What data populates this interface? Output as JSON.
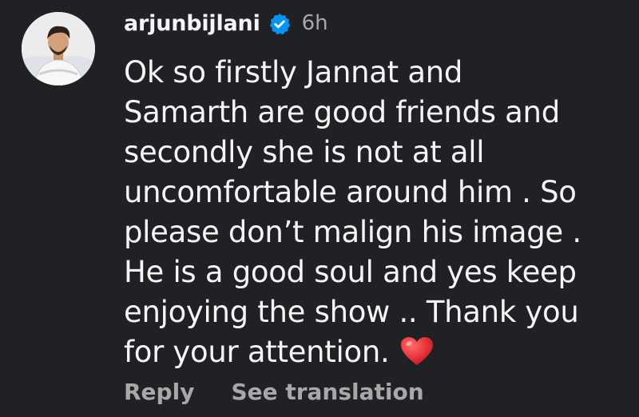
{
  "comment": {
    "username": "arjunbijlani",
    "verified": true,
    "timestamp": "6h",
    "lines": [
      "Ok so firstly Jannat and",
      "Samarth are good friends and",
      "secondly she is not at all",
      "uncomfortable around him . So",
      "please don’t malign his image .",
      "He is a good soul and yes keep",
      "enjoying the show .. Thank you",
      "for your attention."
    ],
    "emoji": "red-heart",
    "actions": {
      "reply": "Reply",
      "see_translation": "See translation"
    }
  },
  "colors": {
    "background": "#202124",
    "text": "#f5f5f5",
    "muted": "#a8a8a8",
    "verified_badge": "#0095f6",
    "heart": "#e8343a"
  },
  "icons": {
    "verified": "verified-badge-icon",
    "heart": "heart-emoji-icon"
  }
}
